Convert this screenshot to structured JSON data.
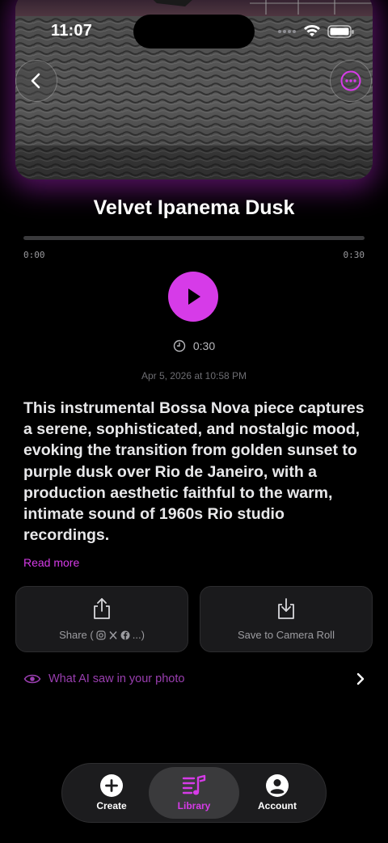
{
  "status_bar": {
    "time": "11:07"
  },
  "header": {
    "back_icon": "chevron-left-icon",
    "more_icon": "ellipsis-circle-icon"
  },
  "player": {
    "title": "Velvet Ipanema Dusk",
    "progress": 0,
    "current_time": "0:00",
    "total_time": "0:30",
    "duration": "0:30",
    "created": "Apr 5, 2026 at 10:58 PM"
  },
  "description": {
    "text": "This instrumental Bossa Nova piece captures a serene, sophisticated, and nostalgic mood, evoking the transition from golden sunset to purple dusk over Rio de Janeiro, with a production aesthetic faithful to the warm, intimate sound of 1960s Rio studio recordings.",
    "read_more": "Read more"
  },
  "actions": {
    "share_prefix": "Share (",
    "share_suffix": "...)",
    "save_label": "Save to Camera Roll"
  },
  "ai_row": {
    "label": "What AI saw in your photo"
  },
  "tabs": [
    {
      "label": "Create",
      "icon": "plus-circle-icon"
    },
    {
      "label": "Library",
      "icon": "music-library-icon",
      "active": true
    },
    {
      "label": "Account",
      "icon": "person-circle-icon"
    }
  ],
  "colors": {
    "accent": "#d63be8",
    "background": "#000000"
  }
}
